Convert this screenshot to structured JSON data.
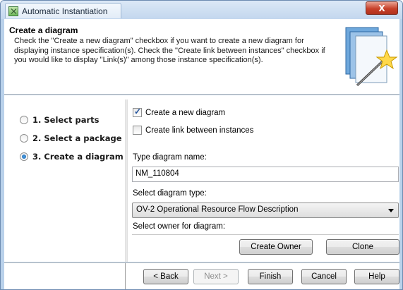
{
  "window": {
    "title": "Automatic Instantiation",
    "close_symbol": "X"
  },
  "header": {
    "title": "Create a diagram",
    "description": "Check the \"Create a new diagram\" checkbox if you want to create a new diagram for displaying instance specification(s). Check the \"Create link between instances\" checkbox if you would like to display \"Link(s)\" among those instance specification(s).",
    "icon": "wizard-wand-icon"
  },
  "steps": [
    {
      "label": "1. Select parts",
      "selected": false
    },
    {
      "label": "2. Select a package",
      "selected": false
    },
    {
      "label": "3. Create a diagram",
      "selected": true
    }
  ],
  "form": {
    "create_new_diagram": {
      "label": "Create a new diagram",
      "checked": true
    },
    "create_link": {
      "label": "Create link between instances",
      "checked": false
    },
    "name_label": "Type diagram name:",
    "name_value": "NM_110804",
    "type_label": "Select diagram type:",
    "type_value": "OV-2 Operational Resource Flow Description",
    "owner_label": "Select owner for diagram:",
    "create_owner_label": "Create Owner",
    "clone_label": "Clone"
  },
  "footer": {
    "back_label": "< Back",
    "next_label": "Next >",
    "finish_label": "Finish",
    "cancel_label": "Cancel",
    "help_label": "Help"
  },
  "colors": {
    "accent": "#1d5fa7",
    "close": "#c7402a"
  }
}
